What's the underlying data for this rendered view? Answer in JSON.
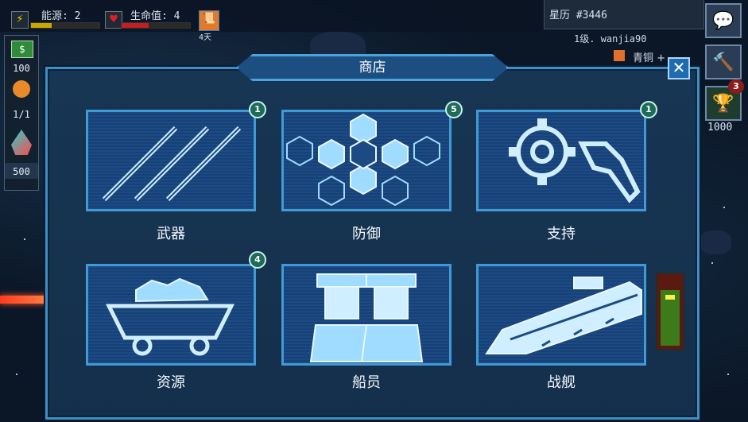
{
  "hud": {
    "energy_label": "能源: 2",
    "energy_level": 0.3,
    "hp_label": "生命值: 4",
    "hp_level": 0.4,
    "days_label": "4天"
  },
  "left_panel": {
    "cash": "100",
    "crew_count": "1/1",
    "crystal": "500"
  },
  "top_right": {
    "star_calendar": "星历 #3446",
    "player": "1级. wanjia90",
    "copper": "青铜 +",
    "trophy_badge": "3",
    "trophy_count": "1000"
  },
  "shop": {
    "title": "商店",
    "categories": [
      {
        "label": "武器",
        "badge": "1",
        "icon": "weapons-icon"
      },
      {
        "label": "防御",
        "badge": "5",
        "icon": "defense-hex-icon"
      },
      {
        "label": "支持",
        "badge": "1",
        "icon": "gear-wrench-icon"
      },
      {
        "label": "资源",
        "badge": "4",
        "icon": "ore-cart-icon"
      },
      {
        "label": "船员",
        "badge": "",
        "icon": "crew-icon"
      },
      {
        "label": "战舰",
        "badge": "",
        "icon": "battleship-icon"
      }
    ]
  },
  "colors": {
    "accent": "#3f9ad6",
    "panel": "#173654",
    "badge": "#1f6b5a"
  }
}
